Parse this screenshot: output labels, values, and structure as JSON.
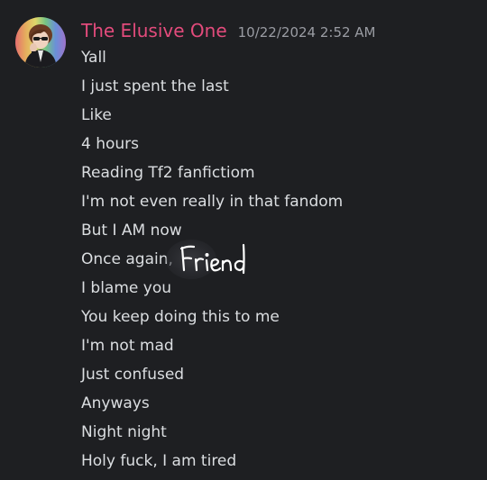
{
  "author": {
    "name": "The Elusive One",
    "name_color": "#e34b7c",
    "timestamp": "10/22/2024 2:52 AM"
  },
  "messages": [
    "Yall",
    "I just spent the last",
    "Like",
    "4 hours",
    "Reading Tf2 fanfictiom",
    "I'm not even really in that fandom",
    "But I AM now",
    "Once again,",
    "I blame you",
    "You keep doing this to me",
    "I'm not mad",
    "Just confused",
    "Anyways",
    "Night night",
    "Holy fuck, I am tired"
  ],
  "handwritten_overlay": "Friend",
  "colors": {
    "background": "#1e1f22",
    "message_text": "#dbdee1",
    "timestamp": "#9a9ca3"
  }
}
